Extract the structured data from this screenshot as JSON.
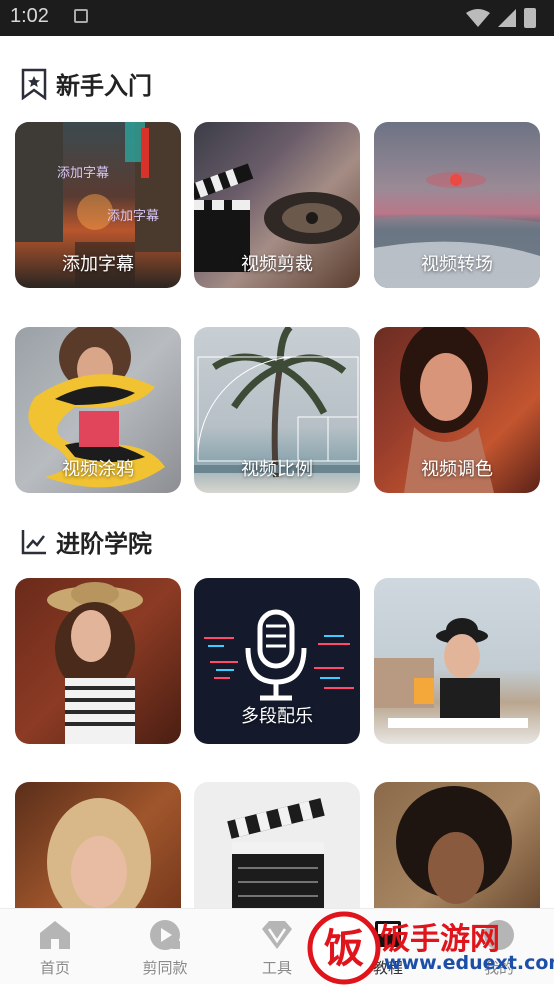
{
  "status_bar": {
    "time": "1:02"
  },
  "sections": [
    {
      "title": "新手入门",
      "icon": "bookmark-star-icon"
    },
    {
      "title": "进阶学院",
      "icon": "trend-chart-icon"
    }
  ],
  "beginner_tiles": [
    {
      "label": "添加字幕",
      "overlay_1": "添加字幕",
      "overlay_2": "添加字幕"
    },
    {
      "label": "视频剪裁"
    },
    {
      "label": "视频转场"
    },
    {
      "label": "视频涂鸦"
    },
    {
      "label": "视频比例"
    },
    {
      "label": "视频调色"
    }
  ],
  "advanced_tiles": [
    {
      "label": ""
    },
    {
      "label": "多段配乐"
    },
    {
      "label": ""
    },
    {
      "label": ""
    },
    {
      "label": ""
    },
    {
      "label": ""
    }
  ],
  "bottom_nav": [
    {
      "label": "首页",
      "icon": "home-icon"
    },
    {
      "label": "剪同款",
      "icon": "play-circle-icon"
    },
    {
      "label": "工具",
      "icon": "diamond-icon"
    },
    {
      "label": "教程",
      "icon": "clapper-icon"
    },
    {
      "label": "我的",
      "icon": "profile-icon"
    }
  ],
  "watermark": {
    "brand": "饭",
    "main": "饭手游网",
    "url": "www.eduext.com"
  },
  "colors": {
    "title": "#222222",
    "nav_inactive": "#8a8a8a",
    "watermark_red": "#e0141b",
    "watermark_blue": "#1d4fa8"
  }
}
